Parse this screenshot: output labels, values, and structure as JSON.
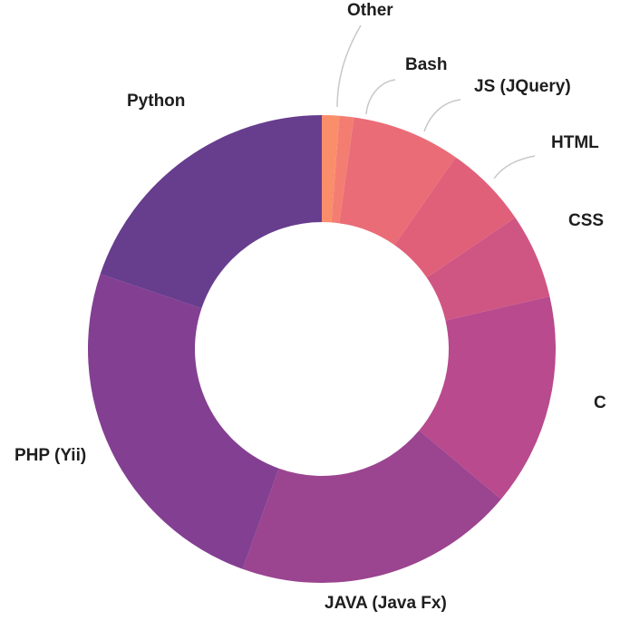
{
  "chart_data": {
    "type": "pie",
    "variant": "donut",
    "title": "",
    "start": "top",
    "direction": "clockwise",
    "unit": "percent (estimated)",
    "slices": [
      {
        "label": "Other",
        "value": 1.2,
        "color": "#fb8e6a"
      },
      {
        "label": "Bash",
        "value": 1.0,
        "color": "#f47d72"
      },
      {
        "label": "JS (JQuery)",
        "value": 7.5,
        "color": "#ea6c76"
      },
      {
        "label": "HTML",
        "value": 5.8,
        "color": "#e06079"
      },
      {
        "label": "CSS",
        "value": 5.9,
        "color": "#cf5683"
      },
      {
        "label": "C",
        "value": 14.7,
        "color": "#b84a8d"
      },
      {
        "label": "JAVA (Java Fx)",
        "value": 19.4,
        "color": "#9b4490"
      },
      {
        "label": "PHP (Yii)",
        "value": 24.7,
        "color": "#833f91"
      },
      {
        "label": "Python",
        "value": 19.8,
        "color": "#673d8e"
      }
    ]
  }
}
